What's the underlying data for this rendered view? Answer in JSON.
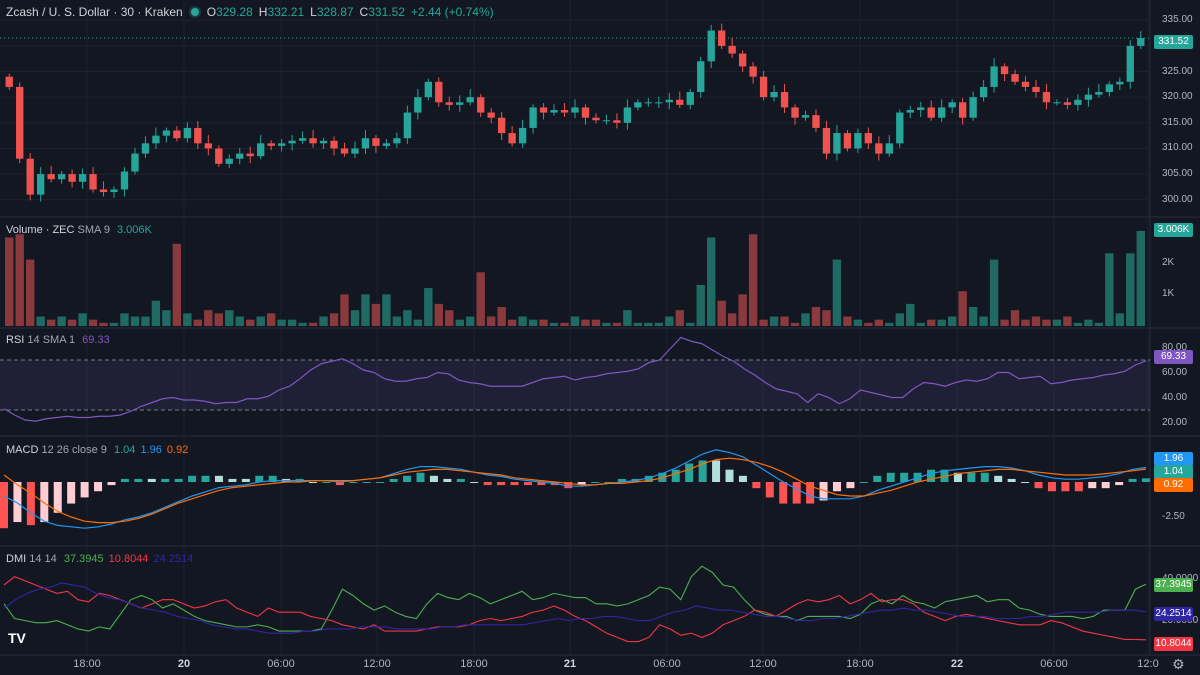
{
  "header": {
    "symbol": "Zcash / U. S. Dollar · 30 · Kraken",
    "o_label": "O",
    "o": "329.28",
    "h_label": "H",
    "h": "332.21",
    "l_label": "L",
    "l": "328.87",
    "c_label": "C",
    "c": "331.52",
    "change": "+2.44 (+0.74%)"
  },
  "indicators": {
    "volume": {
      "name": "Volume · ZEC",
      "params": "SMA 9",
      "value": "3.006K"
    },
    "rsi": {
      "name": "RSI",
      "params": "14 SMA 1",
      "value": "69.33"
    },
    "macd": {
      "name": "MACD",
      "params": "12 26 close 9",
      "macd": "1.04",
      "signal": "1.96",
      "hist": "0.92"
    },
    "dmi": {
      "name": "DMI",
      "params": "14 14",
      "plus": "37.3945",
      "minus": "10.8044",
      "adx": "24.2514"
    }
  },
  "tags": {
    "price": "331.52",
    "volume": "3.006K",
    "rsi": "69.33",
    "macd_signal": "1.96",
    "macd": "1.04",
    "macd_hist": "0.92",
    "dmi_plus": "37.3945",
    "dmi_adx": "24.2514",
    "dmi_minus": "10.8044"
  },
  "price_ticks": [
    "335.00",
    "330.00",
    "325.00",
    "320.00",
    "315.00",
    "310.00",
    "305.00",
    "300.00"
  ],
  "volume_ticks": [
    "2K",
    "1K"
  ],
  "rsi_ticks": [
    "80.00",
    "60.00",
    "40.00",
    "20.00"
  ],
  "macd_ticks": [
    "-2.50"
  ],
  "dmi_ticks": [
    "40.0000",
    "20.0000"
  ],
  "time_ticks": [
    "18:00",
    "20",
    "06:00",
    "12:00",
    "18:00",
    "21",
    "06:00",
    "12:00",
    "18:00",
    "22",
    "06:00",
    "12:0"
  ],
  "colors": {
    "up": "#26a69a",
    "down": "#ef5350",
    "rsi": "#7e57c2",
    "macd": "#2962ff",
    "signal": "#ff6d00",
    "plus": "#4caf50",
    "minus": "#f23645",
    "adx": "#2f26a6"
  },
  "logo": "TV",
  "chart_data": [
    {
      "type": "candlestick",
      "title": "Zcash / U. S. Dollar · 30 · Kraken",
      "ylim": [
        298,
        337
      ],
      "x_ticks": [
        "18:00",
        "20",
        "06:00",
        "12:00",
        "18:00",
        "21",
        "06:00",
        "12:00",
        "18:00",
        "22",
        "06:00",
        "12:0"
      ],
      "close": [
        322.0,
        308.0,
        301.0,
        305.0,
        304.0,
        305.0,
        303.5,
        305.0,
        302.0,
        301.5,
        302.0,
        305.5,
        309.0,
        311.0,
        312.5,
        313.5,
        312.0,
        314.0,
        311.0,
        310.0,
        307.0,
        308.0,
        309.0,
        308.5,
        311.0,
        310.5,
        311.0,
        311.5,
        312.0,
        311.0,
        311.5,
        310.0,
        309.0,
        310.0,
        312.0,
        310.5,
        311.0,
        312.0,
        317.0,
        320.0,
        323.0,
        319.0,
        318.5,
        319.0,
        320.0,
        317.0,
        316.0,
        313.0,
        311.0,
        314.0,
        318.0,
        317.0,
        317.5,
        317.0,
        318.0,
        316.0,
        315.5,
        315.5,
        315.0,
        318.0,
        319.0,
        319.0,
        319.0,
        319.5,
        318.5,
        321.0,
        327.0,
        333.0,
        330.0,
        328.5,
        326.0,
        324.0,
        320.0,
        321.0,
        318.0,
        316.0,
        316.5,
        314.0,
        309.0,
        313.0,
        310.0,
        313.0,
        311.0,
        309.0,
        311.0,
        317.0,
        317.5,
        318.0,
        316.0,
        318.0,
        319.0,
        316.0,
        320.0,
        322.0,
        326.0,
        324.5,
        323.0,
        322.0,
        321.0,
        319.0,
        319.0,
        318.5,
        319.5,
        320.5,
        321.0,
        322.5,
        323.0,
        330.0,
        331.52
      ],
      "volume": [
        2.8,
        2.9,
        2.1,
        0.3,
        0.2,
        0.3,
        0.2,
        0.4,
        0.2,
        0.1,
        0.1,
        0.4,
        0.3,
        0.3,
        0.8,
        0.5,
        2.6,
        0.4,
        0.2,
        0.5,
        0.4,
        0.5,
        0.3,
        0.2,
        0.3,
        0.4,
        0.2,
        0.2,
        0.1,
        0.1,
        0.3,
        0.4,
        1.0,
        0.5,
        1.0,
        0.7,
        1.0,
        0.3,
        0.5,
        0.2,
        1.2,
        0.7,
        0.5,
        0.2,
        0.3,
        1.7,
        0.3,
        0.6,
        0.2,
        0.3,
        0.2,
        0.2,
        0.1,
        0.1,
        0.3,
        0.2,
        0.2,
        0.1,
        0.1,
        0.5,
        0.1,
        0.1,
        0.1,
        0.3,
        0.5,
        0.1,
        1.3,
        2.8,
        0.8,
        0.4,
        1.0,
        2.9,
        0.2,
        0.3,
        0.3,
        0.1,
        0.4,
        0.6,
        0.5,
        2.1,
        0.3,
        0.2,
        0.1,
        0.2,
        0.1,
        0.4,
        0.7,
        0.1,
        0.2,
        0.2,
        0.3,
        1.1,
        0.6,
        0.3,
        2.1,
        0.2,
        0.5,
        0.2,
        0.3,
        0.2,
        0.2,
        0.3,
        0.1,
        0.2,
        0.1,
        2.3,
        0.4,
        2.3,
        3.006
      ],
      "rsi": [
        31,
        26,
        22,
        21,
        23,
        24,
        25,
        24,
        24,
        25,
        25,
        26,
        29,
        33,
        36,
        39,
        40,
        38,
        38,
        37,
        35,
        36,
        36,
        39,
        39,
        41,
        46,
        49,
        55,
        62,
        67,
        69,
        71,
        67,
        62,
        60,
        55,
        53,
        53,
        55,
        56,
        60,
        59,
        54,
        52,
        51,
        49,
        49,
        49,
        49,
        52,
        55,
        56,
        57,
        54,
        56,
        57,
        59,
        60,
        61,
        63,
        68,
        70,
        79,
        88,
        85,
        83,
        78,
        73,
        69,
        63,
        58,
        52,
        47,
        45,
        43,
        36,
        43,
        40,
        35,
        39,
        46,
        44,
        42,
        40,
        40,
        47,
        52,
        51,
        49,
        52,
        54,
        53,
        55,
        60,
        60,
        55,
        56,
        57,
        51,
        52,
        54,
        55,
        56,
        58,
        59,
        61,
        66,
        69.33
      ],
      "macd": [
        -1.0,
        -1.5,
        -2.2,
        -2.8,
        -3.1,
        -3.2,
        -3.3,
        -3.2,
        -3.0,
        -2.7,
        -2.5,
        -2.2,
        -1.8,
        -1.4,
        -1.0,
        -0.7,
        -0.4,
        -0.3,
        -0.2,
        0.0,
        0.1,
        0.1,
        0.1,
        0.1,
        0.1,
        0.0,
        0.1,
        0.2,
        0.3,
        0.6,
        0.9,
        1.1,
        1.1,
        1.0,
        0.9,
        0.7,
        0.5,
        0.4,
        0.2,
        0.1,
        0.0,
        -0.1,
        -0.3,
        -0.3,
        -0.2,
        -0.1,
        0.0,
        0.1,
        0.3,
        0.6,
        1.0,
        1.5,
        2.0,
        2.3,
        2.1,
        1.8,
        1.2,
        0.6,
        0.0,
        -0.5,
        -1.0,
        -1.2,
        -1.2,
        -1.2,
        -1.0,
        -0.6,
        -0.3,
        0.0,
        0.3,
        0.6,
        0.8,
        0.9,
        1.0,
        1.1,
        1.1,
        1.0,
        0.8,
        0.5,
        0.3,
        0.2,
        0.2,
        0.3,
        0.4,
        0.6,
        0.9,
        1.04
      ],
      "signal": [
        0.5,
        -0.2,
        -0.8,
        -1.5,
        -2.1,
        -2.5,
        -2.8,
        -2.9,
        -2.9,
        -2.8,
        -2.6,
        -2.3,
        -1.9,
        -1.5,
        -1.2,
        -0.9,
        -0.6,
        -0.4,
        -0.3,
        -0.2,
        -0.1,
        0.0,
        0.0,
        0.1,
        0.1,
        0.1,
        0.1,
        0.2,
        0.3,
        0.5,
        0.7,
        0.8,
        0.9,
        0.9,
        0.8,
        0.7,
        0.6,
        0.5,
        0.3,
        0.2,
        0.1,
        0.0,
        -0.1,
        -0.2,
        -0.2,
        -0.1,
        -0.1,
        0.0,
        0.1,
        0.3,
        0.6,
        0.9,
        1.3,
        1.6,
        1.7,
        1.6,
        1.4,
        1.1,
        0.7,
        0.2,
        -0.3,
        -0.6,
        -0.9,
        -1.0,
        -1.0,
        -0.8,
        -0.6,
        -0.3,
        0.0,
        0.2,
        0.4,
        0.6,
        0.7,
        0.8,
        0.9,
        0.9,
        0.8,
        0.7,
        0.6,
        0.5,
        0.5,
        0.5,
        0.6,
        0.7,
        0.8,
        0.92
      ],
      "dmi_plus": [
        28,
        21,
        20,
        19,
        19,
        20,
        18,
        16,
        15,
        17,
        16,
        23,
        30,
        32,
        30,
        26,
        28,
        25,
        22,
        20,
        19,
        18,
        17,
        17,
        18,
        17,
        15,
        15,
        15,
        15,
        16,
        25,
        35,
        32,
        28,
        25,
        27,
        24,
        22,
        21,
        28,
        33,
        31,
        30,
        33,
        31,
        28,
        30,
        32,
        34,
        30,
        31,
        33,
        32,
        31,
        31,
        28,
        28,
        27,
        28,
        30,
        32,
        36,
        35,
        30,
        41,
        46,
        43,
        37,
        36,
        30,
        25,
        23,
        22,
        22,
        20,
        22,
        22,
        22,
        22,
        21,
        23,
        28,
        30,
        28,
        32,
        29,
        28,
        26,
        29,
        30,
        31,
        32,
        29,
        30,
        30,
        26,
        25,
        23,
        22,
        22,
        22,
        21,
        22,
        25,
        25,
        25,
        35,
        37.39
      ],
      "dmi_minus": [
        37,
        41,
        39,
        37,
        35,
        33,
        34,
        30,
        29,
        33,
        32,
        30,
        28,
        26,
        28,
        30,
        30,
        28,
        26,
        27,
        29,
        30,
        26,
        24,
        22,
        26,
        24,
        24,
        24,
        22,
        21,
        20,
        18,
        17,
        16,
        18,
        15,
        15,
        15,
        15,
        16,
        17,
        17,
        17,
        18,
        20,
        21,
        20,
        21,
        22,
        24,
        25,
        27,
        25,
        22,
        20,
        17,
        14,
        12,
        10,
        10,
        12,
        18,
        16,
        13,
        14,
        12,
        14,
        18,
        20,
        22,
        25,
        24,
        22,
        25,
        28,
        30,
        29,
        30,
        32,
        28,
        30,
        33,
        29,
        30,
        30,
        28,
        24,
        22,
        20,
        22,
        23,
        22,
        21,
        20,
        19,
        18,
        18,
        18,
        20,
        19,
        17,
        15,
        14,
        13,
        12,
        11,
        11,
        10.8
      ],
      "dmi_adx": [
        26,
        30,
        33,
        35,
        36,
        38,
        37,
        36,
        33,
        31,
        30,
        28,
        26,
        25,
        24,
        22,
        21,
        20,
        18,
        17,
        16,
        16,
        15,
        14,
        14,
        14,
        15,
        15,
        16,
        16,
        16,
        17,
        17,
        17,
        16,
        16,
        16,
        16,
        17,
        17,
        18,
        18,
        18,
        18,
        18,
        18,
        19,
        20,
        21,
        20,
        21,
        21,
        22,
        22,
        21,
        20,
        20,
        22,
        24,
        25,
        27,
        26,
        25,
        25,
        24,
        23,
        22,
        22,
        21,
        20,
        20,
        21,
        21,
        22,
        23,
        24,
        25,
        25,
        26,
        25,
        25,
        24,
        23,
        22,
        22,
        22,
        21,
        21,
        21,
        22,
        22,
        23,
        24,
        24,
        24,
        24,
        25,
        25,
        25,
        24.25
      ]
    }
  ]
}
